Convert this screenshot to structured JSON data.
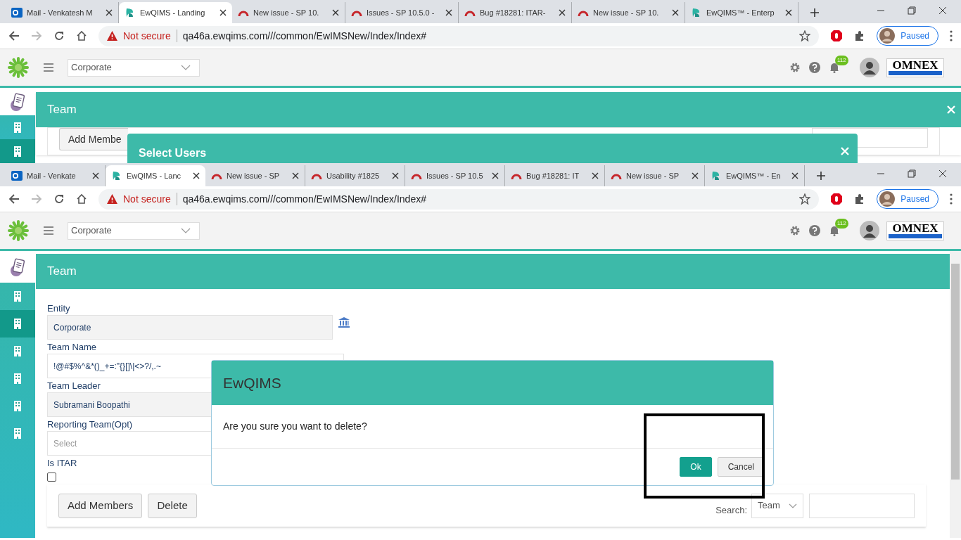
{
  "back_screen": {
    "browser": {
      "tabs": [
        {
          "title": "Mail - Venkatesh M",
          "kind": "mail",
          "selected": false
        },
        {
          "title": "EwQIMS - Landing",
          "kind": "app",
          "selected": true
        },
        {
          "title": "New issue - SP 10.",
          "kind": "tracker",
          "selected": false
        },
        {
          "title": "Issues - SP 10.5.0 -",
          "kind": "tracker",
          "selected": false
        },
        {
          "title": "Bug #18281: ITAR-",
          "kind": "tracker",
          "selected": false
        },
        {
          "title": "New issue - SP 10.",
          "kind": "tracker",
          "selected": false
        },
        {
          "title": "EwQIMS™ - Enterp",
          "kind": "app",
          "selected": false
        }
      ],
      "security": "Not secure",
      "url": "qa46a.ewqims.com///common/EwIMSNew/Index/Index#",
      "profile": "Paused"
    },
    "app_bar": {
      "entity": "Corporate",
      "notifications": "112",
      "logo": "OMNEX"
    },
    "sidebar": [
      {
        "kind": "document",
        "selected": false
      },
      {
        "kind": "building",
        "selected": false
      },
      {
        "kind": "building",
        "selected": true
      }
    ],
    "team_panel": {
      "title": "Team",
      "buttons": [
        "Add Membe"
      ]
    },
    "select_users_dialog": {
      "title": "Select Users"
    }
  },
  "front_screen": {
    "browser": {
      "tabs": [
        {
          "title": "Mail - Venkate",
          "kind": "mail",
          "selected": false
        },
        {
          "title": "EwQIMS - Lanc",
          "kind": "app",
          "selected": true
        },
        {
          "title": "New issue - SP",
          "kind": "tracker",
          "selected": false
        },
        {
          "title": "Usability #1825",
          "kind": "tracker",
          "selected": false
        },
        {
          "title": "Issues - SP 10.5",
          "kind": "tracker",
          "selected": false
        },
        {
          "title": "Bug #18281: IT",
          "kind": "tracker",
          "selected": false
        },
        {
          "title": "New issue - SP",
          "kind": "tracker",
          "selected": false
        },
        {
          "title": "EwQIMS™ - En",
          "kind": "app",
          "selected": false
        }
      ],
      "security": "Not secure",
      "url": "qa46a.ewqims.com///common/EwIMSNew/Index/Index#",
      "profile": "Paused"
    },
    "app_bar": {
      "entity": "Corporate",
      "notifications": "112",
      "logo": "OMNEX"
    },
    "sidebar": [
      {
        "kind": "document",
        "selected": false
      },
      {
        "kind": "building",
        "selected": false
      },
      {
        "kind": "building",
        "selected": true
      },
      {
        "kind": "building",
        "selected": false
      },
      {
        "kind": "building",
        "selected": false
      },
      {
        "kind": "building",
        "selected": false
      },
      {
        "kind": "building",
        "selected": false
      }
    ],
    "team_panel": {
      "title": "Team",
      "fields": [
        {
          "label": "Entity",
          "kind": "entity",
          "value": "Corporate"
        },
        {
          "label": "Team Name",
          "kind": "text",
          "value": "!@#$%^&*()_+=:\"{}[]\\|<>?/,.~"
        },
        {
          "label": "Team Leader",
          "kind": "readonly",
          "value": "Subramani Boopathi"
        },
        {
          "label": "Reporting Team(Opt)",
          "kind": "select",
          "placeholder": "Select"
        }
      ],
      "checkbox": {
        "label": "Is ITAR",
        "checked": false
      },
      "buttons": [
        "Add Members",
        "Delete"
      ],
      "search": {
        "label": "Search:",
        "filter": "Team"
      }
    },
    "confirm_dialog": {
      "title": "EwQIMS",
      "message": "Are you sure you want to delete?",
      "buttons": [
        {
          "label": "Ok",
          "kind": "primary"
        },
        {
          "label": "Cancel",
          "kind": "secondary"
        }
      ]
    }
  }
}
